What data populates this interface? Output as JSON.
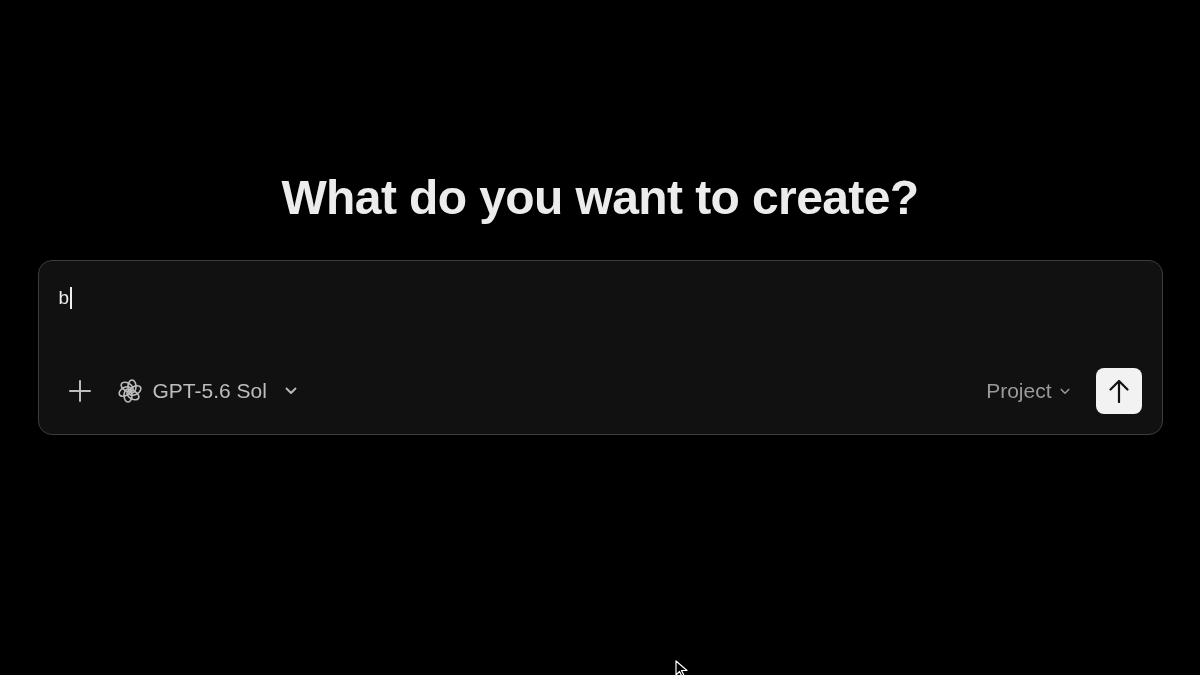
{
  "heading": "What do you want to create?",
  "prompt": {
    "value": "b",
    "focused": true
  },
  "toolbar": {
    "model": {
      "label": "GPT-5.6 Sol"
    },
    "project": {
      "label": "Project"
    }
  }
}
